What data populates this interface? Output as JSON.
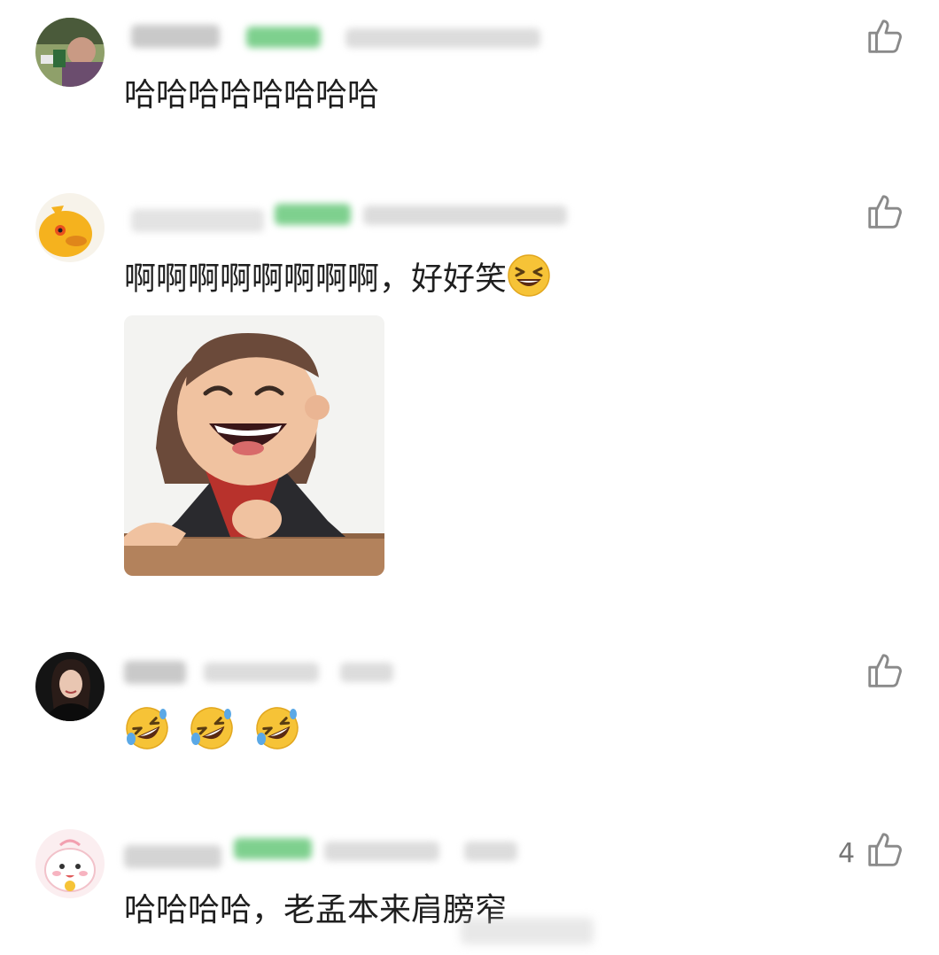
{
  "comments": [
    {
      "text": "哈哈哈哈哈哈哈哈",
      "likes": null
    },
    {
      "text": "啊啊啊啊啊啊啊啊，好好笑",
      "emoji": "laughing-squint-emoji",
      "has_sticker": true,
      "likes": null
    },
    {
      "text": "",
      "emoji": "rofl-emoji",
      "emoji_count": 3,
      "likes": null
    },
    {
      "text": "哈哈哈哈，老孟本来肩膀窄",
      "likes": "4"
    }
  ],
  "icons": {
    "like": "thumbs-up-icon"
  },
  "colors": {
    "badge": "#7ed08e",
    "text": "#1f1f1f",
    "icon": "#8a8a8a"
  }
}
